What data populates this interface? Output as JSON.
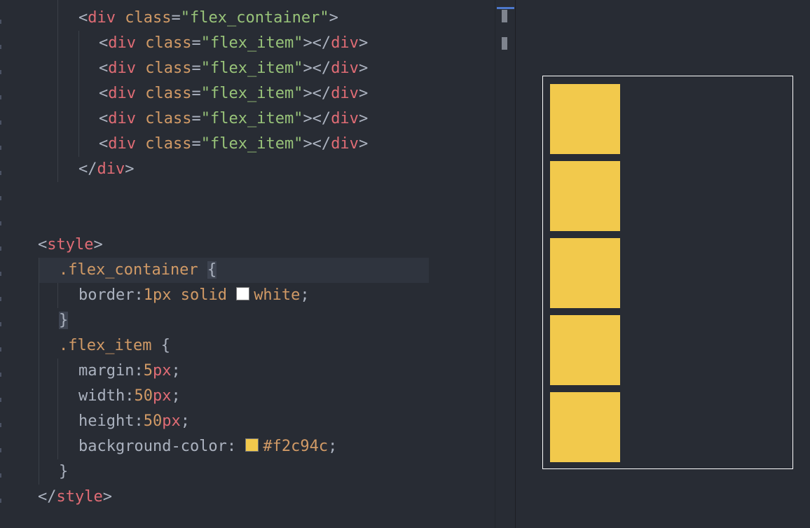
{
  "editor": {
    "lines": [
      {
        "parts": [
          [
            "punct",
            "<"
          ],
          [
            "tag",
            "div"
          ],
          [
            "attr",
            " class"
          ],
          [
            "punct",
            "="
          ],
          [
            "str",
            "\"flex_container\""
          ],
          [
            "punct",
            ">"
          ]
        ]
      },
      {
        "parts": [
          [
            "punct",
            "<"
          ],
          [
            "tag",
            "div"
          ],
          [
            "attr",
            " class"
          ],
          [
            "punct",
            "="
          ],
          [
            "str",
            "\"flex_item\""
          ],
          [
            "punct",
            "></"
          ],
          [
            "tag",
            "div"
          ],
          [
            "punct",
            ">"
          ]
        ]
      },
      {
        "parts": [
          [
            "punct",
            "<"
          ],
          [
            "tag",
            "div"
          ],
          [
            "attr",
            " class"
          ],
          [
            "punct",
            "="
          ],
          [
            "str",
            "\"flex_item\""
          ],
          [
            "punct",
            "></"
          ],
          [
            "tag",
            "div"
          ],
          [
            "punct",
            ">"
          ]
        ]
      },
      {
        "parts": [
          [
            "punct",
            "<"
          ],
          [
            "tag",
            "div"
          ],
          [
            "attr",
            " class"
          ],
          [
            "punct",
            "="
          ],
          [
            "str",
            "\"flex_item\""
          ],
          [
            "punct",
            "></"
          ],
          [
            "tag",
            "div"
          ],
          [
            "punct",
            ">"
          ]
        ]
      },
      {
        "parts": [
          [
            "punct",
            "<"
          ],
          [
            "tag",
            "div"
          ],
          [
            "attr",
            " class"
          ],
          [
            "punct",
            "="
          ],
          [
            "str",
            "\"flex_item\""
          ],
          [
            "punct",
            "></"
          ],
          [
            "tag",
            "div"
          ],
          [
            "punct",
            ">"
          ]
        ]
      },
      {
        "parts": [
          [
            "punct",
            "<"
          ],
          [
            "tag",
            "div"
          ],
          [
            "attr",
            " class"
          ],
          [
            "punct",
            "="
          ],
          [
            "str",
            "\"flex_item\""
          ],
          [
            "punct",
            "></"
          ],
          [
            "tag",
            "div"
          ],
          [
            "punct",
            ">"
          ]
        ]
      },
      {
        "parts": [
          [
            "punct",
            "</"
          ],
          [
            "tag",
            "div"
          ],
          [
            "punct",
            ">"
          ]
        ]
      },
      {
        "parts": [
          [
            "punct",
            "<"
          ],
          [
            "tag",
            "style"
          ],
          [
            "punct",
            ">"
          ]
        ]
      },
      {
        "parts": [
          [
            "sel",
            ".flex_container "
          ],
          [
            "bracehl",
            "{"
          ]
        ]
      },
      {
        "parts": [
          [
            "prop",
            "border:"
          ],
          [
            "num",
            "1px"
          ],
          [
            "kw",
            " solid "
          ],
          [
            "swatch",
            "#ffffff"
          ],
          [
            "kw",
            "white"
          ],
          [
            "punct",
            ";"
          ]
        ]
      },
      {
        "parts": [
          [
            "bracehl",
            "}"
          ]
        ]
      },
      {
        "parts": [
          [
            "sel",
            ".flex_item "
          ],
          [
            "punct",
            "{"
          ]
        ]
      },
      {
        "parts": [
          [
            "prop",
            "margin:"
          ],
          [
            "num",
            "5"
          ],
          [
            "unit",
            "px"
          ],
          [
            "punct",
            ";"
          ]
        ]
      },
      {
        "parts": [
          [
            "prop",
            "width:"
          ],
          [
            "num",
            "50"
          ],
          [
            "unit",
            "px"
          ],
          [
            "punct",
            ";"
          ]
        ]
      },
      {
        "parts": [
          [
            "prop",
            "height:"
          ],
          [
            "num",
            "50"
          ],
          [
            "unit",
            "px"
          ],
          [
            "punct",
            ";"
          ]
        ]
      },
      {
        "parts": [
          [
            "prop",
            "background-color: "
          ],
          [
            "swatch",
            "#f2c94c"
          ],
          [
            "kw",
            "#f2c94c"
          ],
          [
            "punct",
            ";"
          ]
        ]
      },
      {
        "parts": [
          [
            "punct",
            "}"
          ]
        ]
      },
      {
        "parts": [
          [
            "punct",
            "</"
          ],
          [
            "tag",
            "style"
          ],
          [
            "punct",
            ">"
          ]
        ]
      }
    ]
  },
  "preview": {
    "item_color": "#f2c94c",
    "item_count": 5,
    "container_border_color": "#ffffff"
  }
}
